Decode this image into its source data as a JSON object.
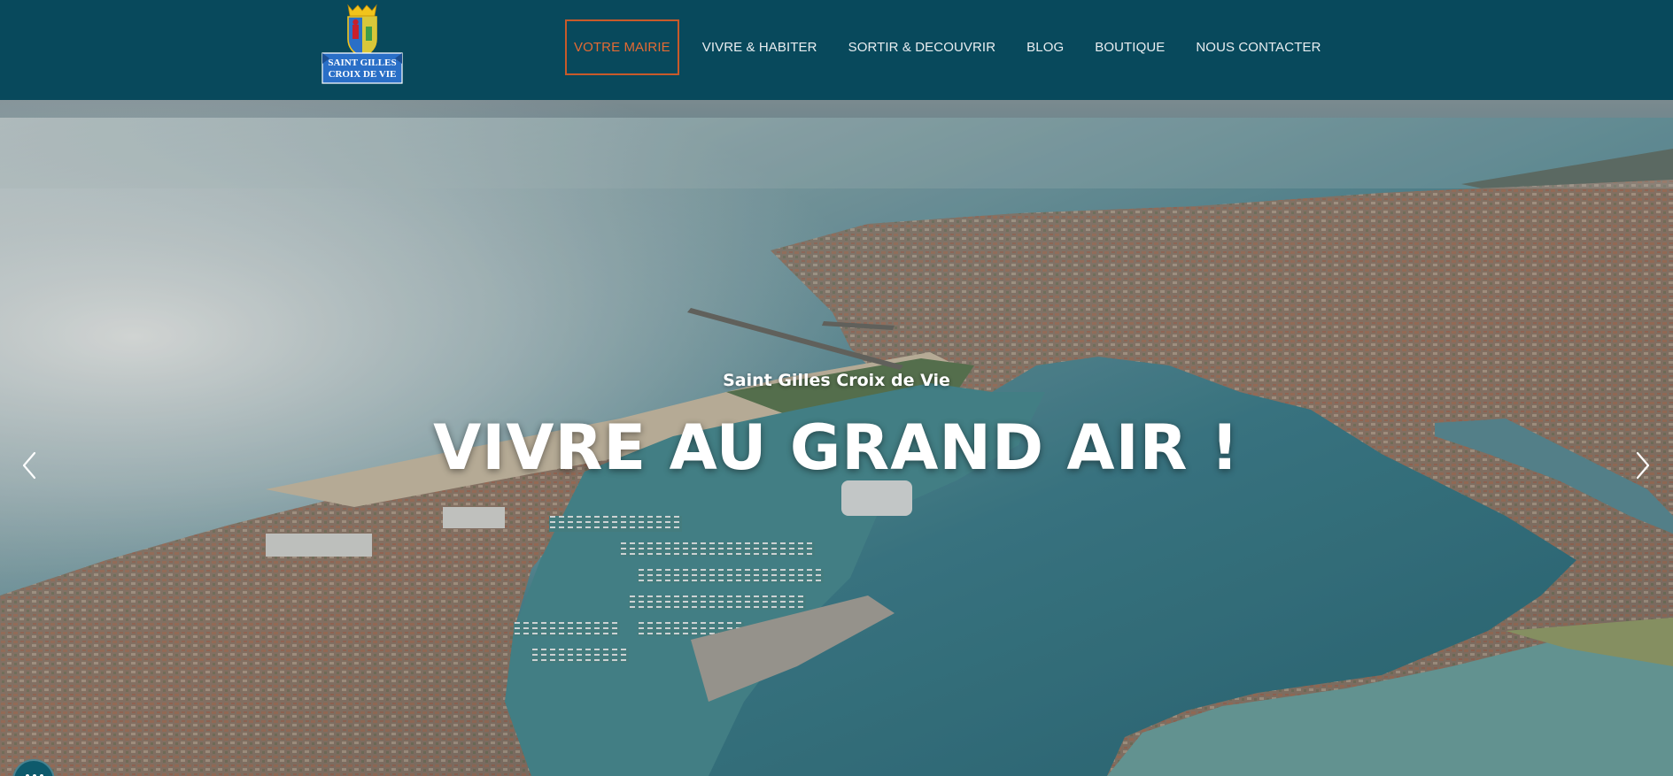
{
  "logo": {
    "line1": "SAINT GILLES",
    "line2": "CROIX DE VIE",
    "colors": {
      "blue": "#2a6fc7",
      "gold": "#f2c41b",
      "red": "#c8202c",
      "white": "#ffffff"
    }
  },
  "nav": {
    "items": [
      {
        "label": "VOTRE MAIRIE",
        "active": true
      },
      {
        "label": "VIVRE & HABITER",
        "active": false
      },
      {
        "label": "SORTIR & DECOUVRIR",
        "active": false
      },
      {
        "label": "BLOG",
        "active": false
      },
      {
        "label": "BOUTIQUE",
        "active": false
      },
      {
        "label": "NOUS CONTACTER",
        "active": false
      }
    ]
  },
  "hero": {
    "subtitle": "Saint Gilles Croix de Vie",
    "title": "VIVRE AU GRAND AIR !",
    "prev_icon": "chevron-left-icon",
    "next_icon": "chevron-right-icon"
  },
  "colors": {
    "header_bg": "#08495c",
    "active_nav": "#e46a33",
    "sea": "#4f8f9a",
    "sky": "#c9d3d6"
  }
}
